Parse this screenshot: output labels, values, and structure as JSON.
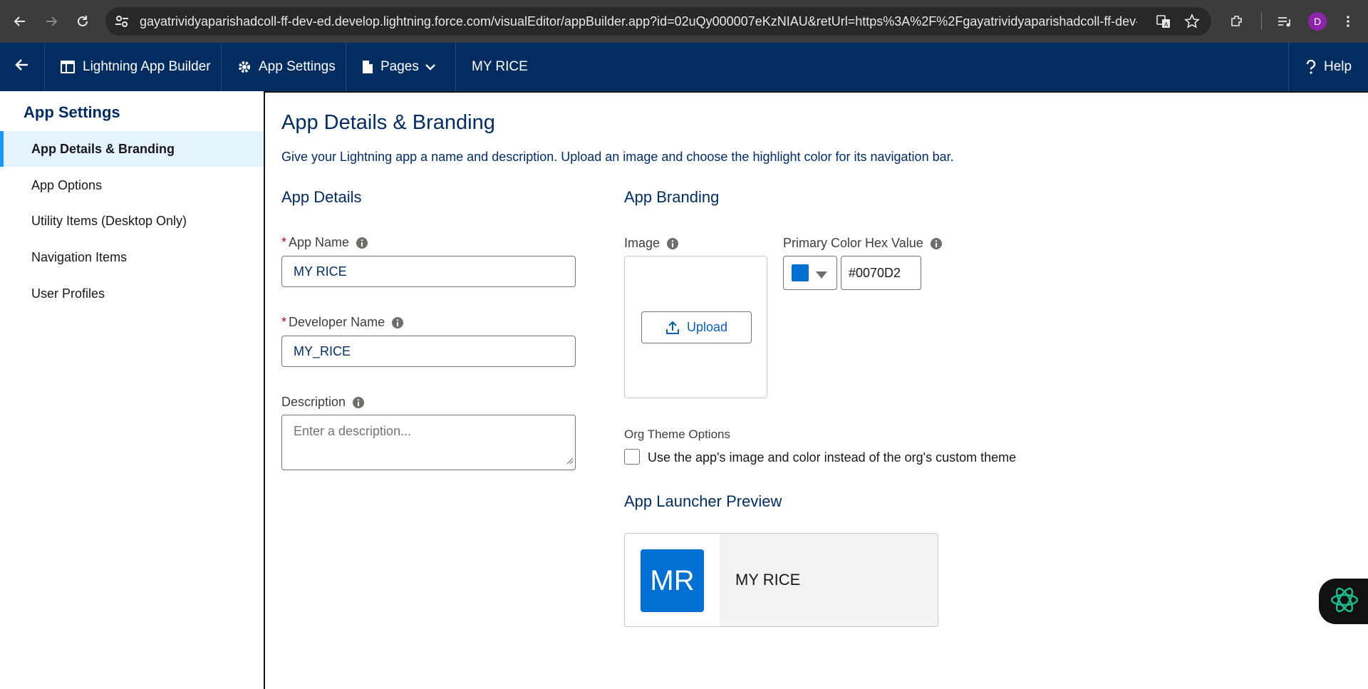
{
  "browser": {
    "url": "gayatrividyaparishadcoll-ff-dev-ed.develop.lightning.force.com/visualEditor/appBuilder.app?id=02uQy000007eKzNIAU&retUrl=https%3A%2F%2Fgayatrividyaparishadcoll-ff-dev-ed....",
    "profile_initial": "D"
  },
  "header": {
    "app_builder": "Lightning App Builder",
    "app_settings": "App Settings",
    "pages": "Pages",
    "app_name": "MY RICE",
    "help": "Help"
  },
  "sidebar": {
    "title": "App Settings",
    "items": [
      {
        "label": "App Details & Branding"
      },
      {
        "label": "App Options"
      },
      {
        "label": "Utility Items (Desktop Only)"
      },
      {
        "label": "Navigation Items"
      },
      {
        "label": "User Profiles"
      }
    ]
  },
  "main": {
    "title": "App Details & Branding",
    "subtitle": "Give your Lightning app a name and description. Upload an image and choose the highlight color for its navigation bar.",
    "details": {
      "heading": "App Details",
      "app_name_label": "App Name",
      "app_name_value": "MY RICE",
      "developer_name_label": "Developer Name",
      "developer_name_value": "MY_RICE",
      "description_label": "Description",
      "description_placeholder": "Enter a description..."
    },
    "branding": {
      "heading": "App Branding",
      "image_label": "Image",
      "upload_label": "Upload",
      "color_label": "Primary Color Hex Value",
      "color_value": "#0070D2",
      "swatch_color": "#0070d2",
      "org_theme_label": "Org Theme Options",
      "org_theme_checkbox_label": "Use the app's image and color instead of the org's custom theme",
      "org_theme_checked": false
    },
    "preview": {
      "heading": "App Launcher Preview",
      "initials": "MR",
      "name": "MY RICE"
    }
  }
}
